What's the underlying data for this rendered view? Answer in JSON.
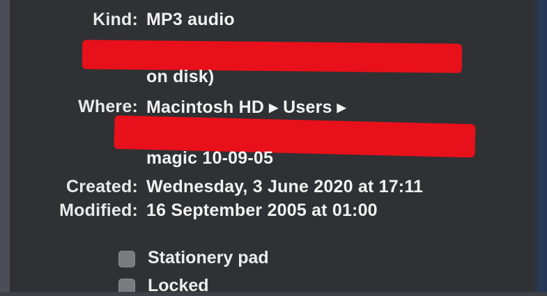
{
  "info": {
    "kind_label": "Kind:",
    "kind_value": "MP3 audio",
    "size_value_line2": "on disk)",
    "where_label": "Where:",
    "where_value_line1": "Macintosh HD ▸ Users ▸",
    "where_value_line3": "magic 10-09-05",
    "created_label": "Created:",
    "created_value": "Wednesday, 3 June 2020 at 17:11",
    "modified_label": "Modified:",
    "modified_value": "16 September 2005 at 01:00"
  },
  "options": {
    "stationery_label": "Stationery pad",
    "stationery_checked": false,
    "locked_label": "Locked",
    "locked_checked": false
  },
  "colors": {
    "panel_bg": "#303134",
    "text": "#f2f2f2",
    "redaction": "#e8101a"
  }
}
